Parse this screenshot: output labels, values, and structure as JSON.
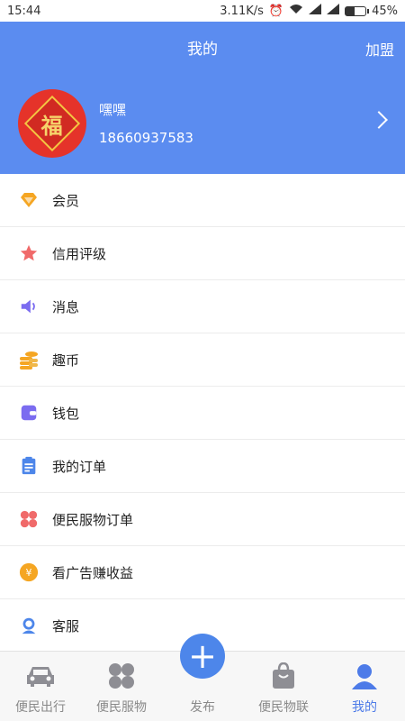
{
  "status_bar": {
    "time": "15:44",
    "speed": "3.11K/s",
    "battery": "45%",
    "battery_level": 0.45
  },
  "header": {
    "title": "我的",
    "action": "加盟"
  },
  "profile": {
    "name": "嘿嘿",
    "phone": "18660937583",
    "avatar_text": "福"
  },
  "menu": [
    {
      "label": "会员",
      "icon": "diamond-icon",
      "color": "#f5a623"
    },
    {
      "label": "信用评级",
      "icon": "star-icon",
      "color": "#f06a6a"
    },
    {
      "label": "消息",
      "icon": "speaker-icon",
      "color": "#7b6cf0"
    },
    {
      "label": "趣币",
      "icon": "coins-icon",
      "color": "#f5a623"
    },
    {
      "label": "钱包",
      "icon": "wallet-icon",
      "color": "#7b6cf0"
    },
    {
      "label": "我的订单",
      "icon": "clipboard-icon",
      "color": "#4d86ea"
    },
    {
      "label": "便民服物订单",
      "icon": "clover-icon",
      "color": "#f06a6a"
    },
    {
      "label": "看广告赚收益",
      "icon": "yen-coin-icon",
      "color": "#f5a623"
    },
    {
      "label": "客服",
      "icon": "headset-icon",
      "color": "#4d86ea"
    }
  ],
  "tabs": [
    {
      "label": "便民出行",
      "icon": "car-icon"
    },
    {
      "label": "便民服物",
      "icon": "grid-icon"
    },
    {
      "label": "发布",
      "icon": "plus-icon"
    },
    {
      "label": "便民物联",
      "icon": "bag-icon"
    },
    {
      "label": "我的",
      "icon": "user-icon",
      "active": true
    }
  ],
  "colors": {
    "brand": "#5b8cf0",
    "tab_active": "#4d7be8"
  }
}
